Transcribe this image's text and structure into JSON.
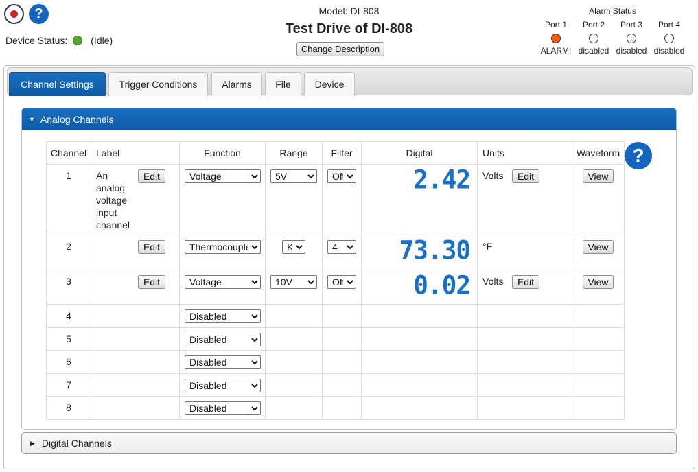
{
  "header": {
    "model": "Model: DI-808",
    "title": "Test Drive of DI-808",
    "change_description": "Change Description",
    "device_status_label": "Device Status:",
    "device_status_value": "(Idle)",
    "help_glyph": "?"
  },
  "alarm_status": {
    "title": "Alarm Status",
    "ports": [
      {
        "label": "Port 1",
        "status": "ALARM!"
      },
      {
        "label": "Port 2",
        "status": "disabled"
      },
      {
        "label": "Port 3",
        "status": "disabled"
      },
      {
        "label": "Port 4",
        "status": "disabled"
      }
    ]
  },
  "tabs": [
    "Channel Settings",
    "Trigger Conditions",
    "Alarms",
    "File",
    "Device"
  ],
  "analog_panel": {
    "title": "Analog Channels"
  },
  "digital_panel": {
    "title": "Digital Channels"
  },
  "table": {
    "headers": [
      "Channel",
      "Label",
      "Function",
      "Range",
      "Filter",
      "Digital",
      "Units",
      "Waveform"
    ],
    "edit_label": "Edit",
    "view_label": "View",
    "rows": [
      {
        "channel": "1",
        "label": "An analog voltage input channel",
        "function": "Voltage",
        "range": "5V",
        "filter": "Off",
        "digital": "2.42",
        "units": "Volts"
      },
      {
        "channel": "2",
        "label": "",
        "function": "Thermocouple",
        "range": "K",
        "filter": "4",
        "digital": "73.30",
        "units": "°F"
      },
      {
        "channel": "3",
        "label": "",
        "function": "Voltage",
        "range": "10V",
        "filter": "Off",
        "digital": "0.02",
        "units": "Volts"
      },
      {
        "channel": "4",
        "function": "Disabled"
      },
      {
        "channel": "5",
        "function": "Disabled"
      },
      {
        "channel": "6",
        "function": "Disabled"
      },
      {
        "channel": "7",
        "function": "Disabled"
      },
      {
        "channel": "8",
        "function": "Disabled"
      }
    ]
  },
  "colors": {
    "accent": "#0c5aa6",
    "alarm": "#ff5a00",
    "idle": "#55a630",
    "digital": "#1a70c8"
  }
}
